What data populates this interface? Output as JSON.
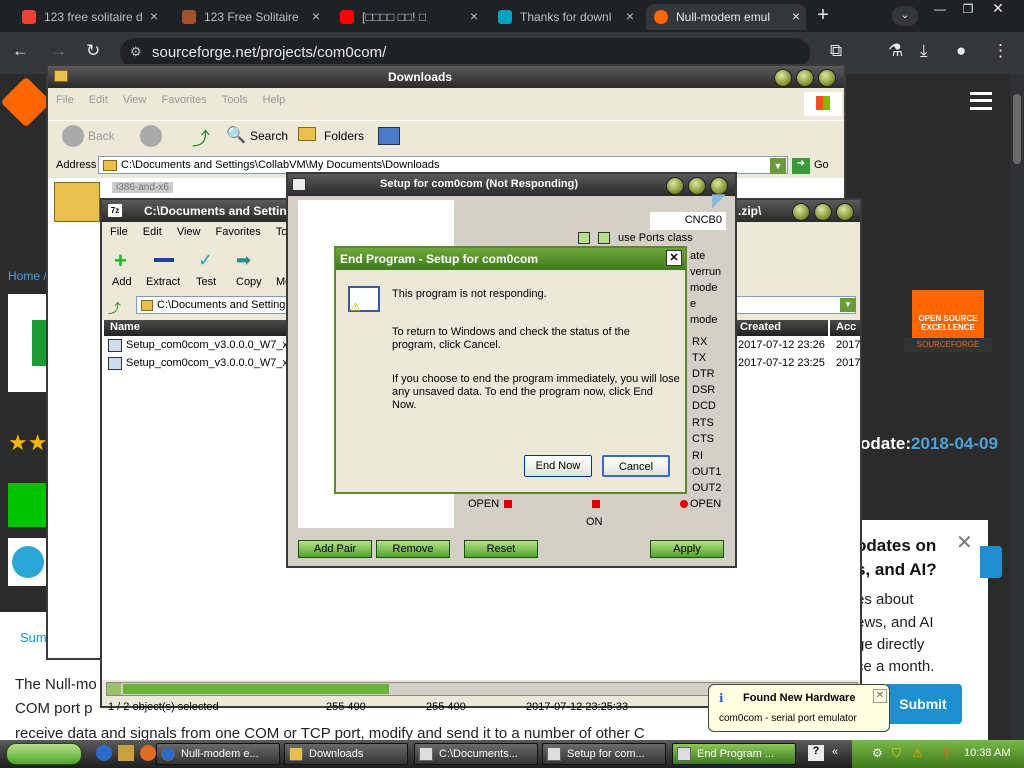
{
  "browser": {
    "tabs": [
      {
        "title": "123 free solitaire d",
        "color": "#ea4335"
      },
      {
        "title": "123 Free Solitaire",
        "color": "#a0522d"
      },
      {
        "title": "[□□□□ □□! □",
        "color": "#ff0000"
      },
      {
        "title": "Thanks for downl",
        "color": "#00a3c4"
      },
      {
        "title": "Null-modem emul",
        "color": "#ff6600"
      }
    ],
    "url": "sourceforge.net/projects/com0com/"
  },
  "site": {
    "breadcrumb": "Home /",
    "badge_line1": "OPEN SOURCE",
    "badge_line2": "EXCELLENCE",
    "badge_brand": "SOURCEFORGE",
    "update_label": "odate:",
    "update_date": "2018-04-09",
    "popup_l1": "odates on",
    "popup_l2": "s, and AI?",
    "popup_l3": "es about",
    "popup_l4": "ews, and AI",
    "popup_l5": "ge directly",
    "popup_l6": "ce a month.",
    "submit": "Submit",
    "summary_tab": "Sum",
    "para1": "The Null-mo",
    "para2": "COM port p",
    "para3": "receive data and signals from one COM or TCP port, modify and send it to a number of other C"
  },
  "explorer": {
    "title": "Downloads",
    "menu": [
      "File",
      "Edit",
      "View",
      "Favorites",
      "Tools",
      "Help"
    ],
    "back": "Back",
    "search": "Search",
    "folders": "Folders",
    "address_label": "Address",
    "address": "C:\\Documents and Settings\\CollabVM\\My Documents\\Downloads",
    "go": "Go",
    "file_partial": "i386-and-x6"
  },
  "sevenzip": {
    "title": "C:\\Documents and Settin",
    "title_tail": ".zip\\",
    "menu": [
      "File",
      "Edit",
      "View",
      "Favorites",
      "Tools"
    ],
    "tools": [
      "Add",
      "Extract",
      "Test",
      "Copy",
      "Mo"
    ],
    "path": "C:\\Documents and Settings",
    "col_name": "Name",
    "col_created": "Created",
    "col_acc": "Acc",
    "rows": [
      {
        "name": "Setup_com0com_v3.0.0.0_W7_x",
        "created": "2017-07-12 23:26",
        "acc": "2017"
      },
      {
        "name": "Setup_com0com_v3.0.0.0_W7_x",
        "created": "2017-07-12 23:25",
        "acc": "2017"
      }
    ],
    "status_sel": "1 / 2 object(s) selected",
    "status_size": "255 400",
    "status_packed": "255 400",
    "status_date": "2017-07-12 23:25:33"
  },
  "setup": {
    "title": "Setup for com0com (Not Responding)",
    "port": "CNCB0",
    "ports_class": "use Ports class",
    "opts": [
      "ate",
      "verrun",
      "mode",
      "e",
      "mode"
    ],
    "signals": [
      "RX",
      "TX",
      "DTR",
      "DSR",
      "DCD",
      "RTS",
      "CTS",
      "RI",
      "OUT1",
      "OUT2"
    ],
    "open_left": "OPEN",
    "open_right": "OPEN",
    "on": "ON",
    "add_pair": "Add Pair",
    "remove": "Remove",
    "reset": "Reset",
    "apply": "Apply"
  },
  "endprog": {
    "title": "End Program - Setup for com0com",
    "line1": "This program is not responding.",
    "line2a": "To return to Windows and check the status of the",
    "line2b": "program, click Cancel.",
    "line3a": "If you choose to end the program immediately, you will lose",
    "line3b": "any unsaved data. To end the program now, click End",
    "line3c": "Now.",
    "end_now": "End Now",
    "cancel": "Cancel"
  },
  "notify": {
    "title": "Found New Hardware",
    "body": "com0com - serial port emulator"
  },
  "taskbar": {
    "items": [
      "Null-modem e...",
      "Downloads",
      "C:\\Documents...",
      "Setup for com...",
      "End Program ..."
    ],
    "clock": "10:38 AM"
  }
}
